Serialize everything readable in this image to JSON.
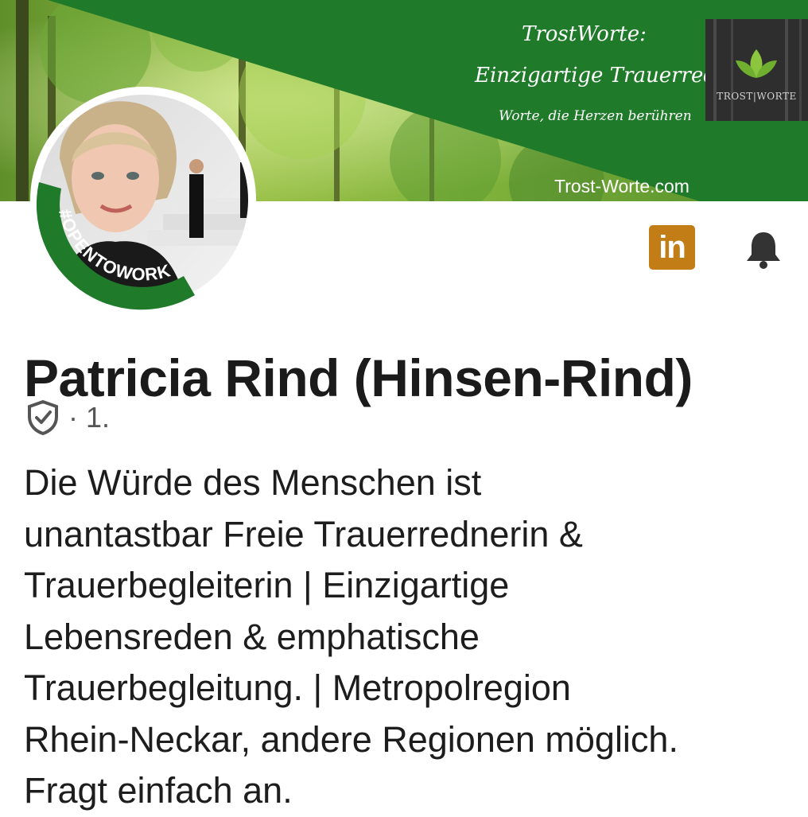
{
  "banner": {
    "title_line1": "TrostWorte:",
    "title_line2": "Einzigartige Trauerreden",
    "tagline": "Worte, die Herzen berühren",
    "website": "Trost-Worte.com",
    "logo_text": "TROST|WORTE",
    "colors": {
      "green": "#1f7a2a",
      "forest": "#4f9a3a"
    }
  },
  "avatar": {
    "badge_text": "#OPENTOWORK",
    "badge_color": "#1f7a2a"
  },
  "actions": {
    "linkedin_label": "in",
    "linkedin_color": "#c37d16",
    "bell_icon": "bell-icon"
  },
  "profile": {
    "name": "Patricia Rind (Hinsen-Rind)",
    "degree": "· 1.",
    "headline_lines": [
      "Die Würde des Menschen ist",
      "unantastbar Freie Trauerrednerin &",
      "Trauerbegleiterin | Einzigartige",
      "Lebensreden & emphatische",
      "Trauerbegleitung. | Metropolregion",
      "Rhein-Neckar, andere Regionen möglich.",
      "Fragt einfach an."
    ]
  }
}
